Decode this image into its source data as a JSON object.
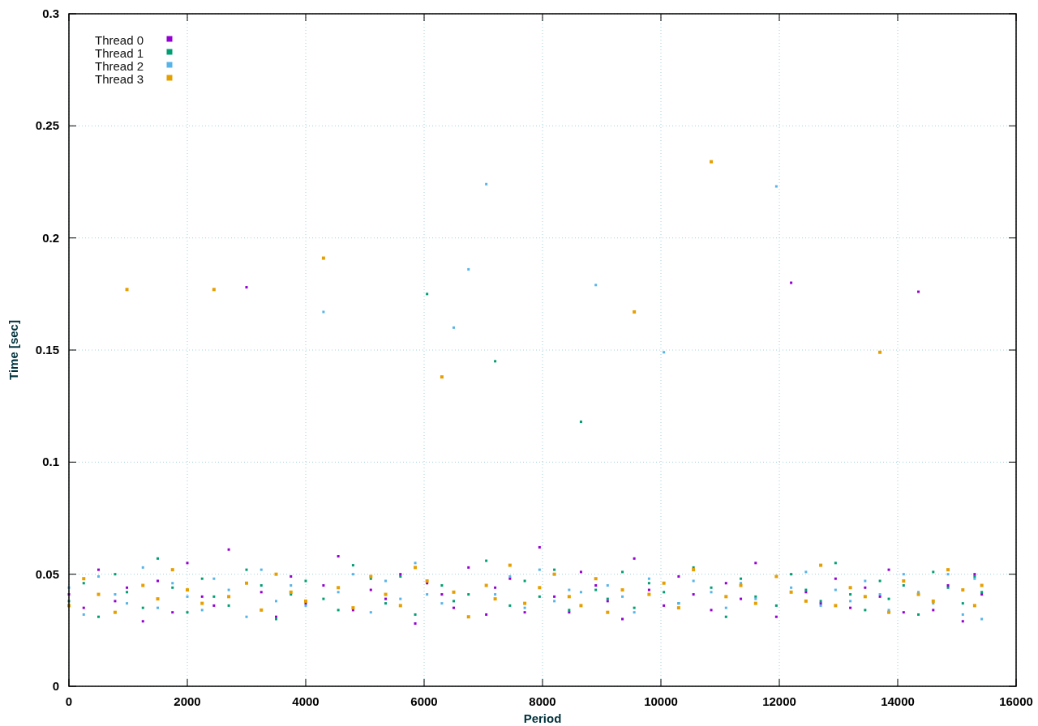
{
  "chart_data": {
    "type": "scatter",
    "grid": true,
    "legend": true,
    "xlabel": "Period",
    "ylabel": "Time [sec]",
    "xlim": [
      0,
      16000
    ],
    "ylim": [
      0,
      0.3
    ],
    "xticks": [
      0,
      2000,
      4000,
      6000,
      8000,
      10000,
      12000,
      14000,
      16000
    ],
    "yticks": [
      0,
      0.05,
      0.1,
      0.15,
      0.2,
      0.25,
      0.3
    ],
    "x": [
      0,
      250,
      500,
      780,
      980,
      1250,
      1500,
      1750,
      2000,
      2250,
      2450,
      2700,
      3000,
      3250,
      3500,
      3750,
      4000,
      4300,
      4550,
      4800,
      5100,
      5350,
      5600,
      5850,
      6050,
      6300,
      6500,
      6750,
      7050,
      7200,
      7450,
      7700,
      7950,
      8200,
      8450,
      8650,
      8900,
      9100,
      9350,
      9550,
      9800,
      10050,
      10300,
      10550,
      10850,
      11100,
      11350,
      11600,
      11950,
      12200,
      12450,
      12700,
      12950,
      13200,
      13450,
      13700,
      13850,
      14100,
      14350,
      14600,
      14850,
      15100,
      15300,
      15420
    ],
    "series": [
      {
        "name": "Thread 0",
        "color": "#9400d3",
        "values": [
          0.041,
          0.035,
          0.052,
          0.038,
          0.044,
          0.029,
          0.047,
          0.033,
          0.055,
          0.04,
          0.036,
          0.061,
          0.178,
          0.042,
          0.031,
          0.049,
          0.037,
          0.045,
          0.058,
          0.034,
          0.043,
          0.039,
          0.05,
          0.028,
          0.046,
          0.041,
          0.035,
          0.053,
          0.032,
          0.044,
          0.048,
          0.033,
          0.062,
          0.04,
          0.033,
          0.051,
          0.045,
          0.038,
          0.03,
          0.057,
          0.043,
          0.036,
          0.049,
          0.041,
          0.034,
          0.046,
          0.039,
          0.055,
          0.031,
          0.18,
          0.042,
          0.037,
          0.048,
          0.035,
          0.044,
          0.04,
          0.052,
          0.033,
          0.176,
          0.034,
          0.045,
          0.029,
          0.05,
          0.041
        ]
      },
      {
        "name": "Thread 1",
        "color": "#009e73",
        "values": [
          0.038,
          0.046,
          0.031,
          0.05,
          0.042,
          0.035,
          0.057,
          0.044,
          0.033,
          0.048,
          0.04,
          0.036,
          0.052,
          0.045,
          0.03,
          0.041,
          0.047,
          0.039,
          0.034,
          0.054,
          0.048,
          0.037,
          0.049,
          0.032,
          0.175,
          0.045,
          0.038,
          0.041,
          0.056,
          0.145,
          0.036,
          0.047,
          0.04,
          0.052,
          0.034,
          0.118,
          0.043,
          0.039,
          0.051,
          0.035,
          0.046,
          0.042,
          0.037,
          0.053,
          0.044,
          0.031,
          0.048,
          0.04,
          0.036,
          0.05,
          0.043,
          0.038,
          0.055,
          0.041,
          0.034,
          0.047,
          0.039,
          0.045,
          0.032,
          0.051,
          0.044,
          0.037,
          0.049,
          0.042
        ]
      },
      {
        "name": "Thread 2",
        "color": "#56b4e9",
        "values": [
          0.044,
          0.032,
          0.049,
          0.041,
          0.037,
          0.053,
          0.035,
          0.046,
          0.04,
          0.034,
          0.048,
          0.043,
          0.031,
          0.052,
          0.038,
          0.045,
          0.036,
          0.167,
          0.042,
          0.05,
          0.033,
          0.047,
          0.039,
          0.055,
          0.041,
          0.037,
          0.16,
          0.186,
          0.224,
          0.041,
          0.049,
          0.035,
          0.052,
          0.038,
          0.043,
          0.042,
          0.179,
          0.045,
          0.04,
          0.033,
          0.048,
          0.149,
          0.037,
          0.047,
          0.042,
          0.035,
          0.046,
          0.039,
          0.223,
          0.044,
          0.051,
          0.036,
          0.043,
          0.038,
          0.047,
          0.041,
          0.034,
          0.05,
          0.042,
          0.037,
          0.05,
          0.032,
          0.048,
          0.03
        ]
      },
      {
        "name": "Thread 3",
        "color": "#e69f00",
        "values": [
          0.036,
          0.048,
          0.041,
          0.033,
          0.177,
          0.045,
          0.039,
          0.052,
          0.043,
          0.037,
          0.177,
          0.04,
          0.046,
          0.034,
          0.05,
          0.042,
          0.038,
          0.191,
          0.044,
          0.035,
          0.049,
          0.041,
          0.036,
          0.053,
          0.047,
          0.138,
          0.042,
          0.031,
          0.045,
          0.039,
          0.054,
          0.037,
          0.044,
          0.05,
          0.04,
          0.036,
          0.048,
          0.033,
          0.043,
          0.167,
          0.041,
          0.046,
          0.035,
          0.052,
          0.234,
          0.04,
          0.045,
          0.037,
          0.049,
          0.042,
          0.038,
          0.054,
          0.036,
          0.044,
          0.04,
          0.149,
          0.033,
          0.047,
          0.041,
          0.038,
          0.052,
          0.043,
          0.036,
          0.045
        ]
      }
    ]
  }
}
